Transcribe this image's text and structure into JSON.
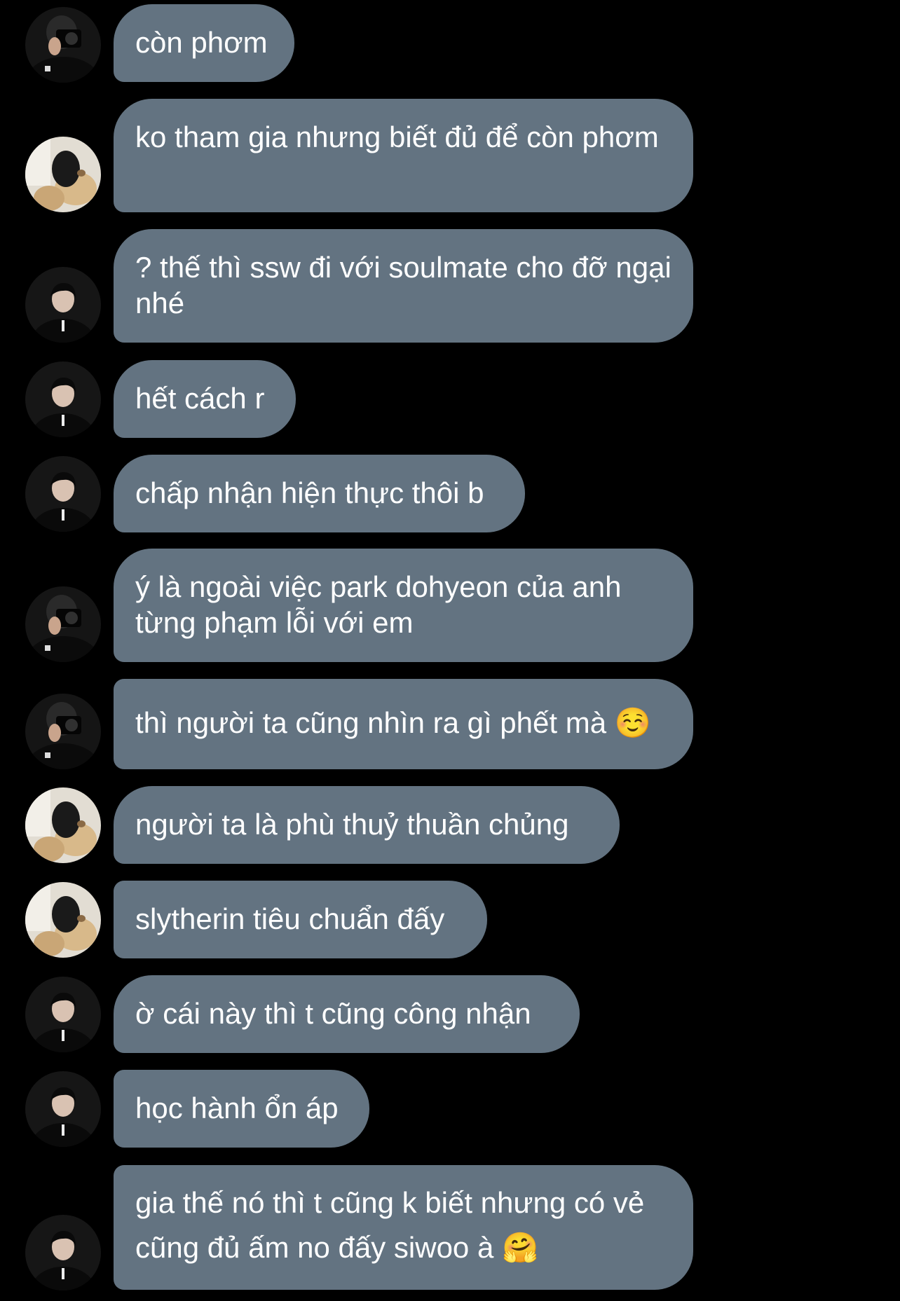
{
  "conversation": {
    "messages": [
      {
        "sender": "camera",
        "text": "còn phơm"
      },
      {
        "sender": "bear",
        "text": "ko tham gia nhưng biết đủ để còn phơm"
      },
      {
        "sender": "boy",
        "text": "? thế thì ssw đi với soulmate cho đỡ ngại nhé"
      },
      {
        "sender": "boy",
        "text": "hết cách r"
      },
      {
        "sender": "boy",
        "text": "chấp nhận hiện thực thôi b"
      },
      {
        "sender": "camera",
        "text": "ý là ngoài việc park dohyeon của anh từng phạm lỗi với em"
      },
      {
        "sender": "camera",
        "text": "thì người ta cũng nhìn ra gì phết mà ☺️"
      },
      {
        "sender": "bear",
        "text": "người ta là phù thuỷ thuần chủng"
      },
      {
        "sender": "bear",
        "text": "slytherin tiêu chuẩn đấy"
      },
      {
        "sender": "boy",
        "text": "ờ cái này thì t cũng công nhận"
      },
      {
        "sender": "boy",
        "text": "học hành ổn áp"
      },
      {
        "sender": "boy",
        "text": "gia thế nó thì t cũng k biết nhưng có vẻ cũng đủ ấm no đấy siwoo à 🤗"
      }
    ]
  },
  "colors": {
    "background": "#000000",
    "bubble": "#637381",
    "text": "#ffffff"
  },
  "icons": {
    "camera": "avatar-camera-icon",
    "bear": "avatar-teddy-bear-icon",
    "boy": "avatar-person-icon"
  }
}
